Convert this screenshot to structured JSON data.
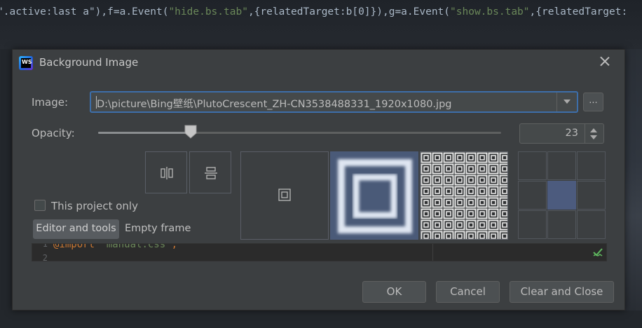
{
  "background_editor": {
    "p1": "\".active:last a\"),f=a.Event(",
    "p2": "\"hide.bs.tab\"",
    "p3": ",{relatedTarget:b[0]}),g=a.Event(",
    "p4": "\"show.bs.tab\"",
    "p5": ",{relatedTarget:"
  },
  "dialog": {
    "title": "Background Image",
    "app_logo_text": "WS",
    "image_label": "Image:",
    "image_path": "D:\\picture\\Bing壁纸\\PlutoCrescent_ZH-CN3538488331_1920x1080.jpg",
    "browse_label": "...",
    "opacity_label": "Opacity:",
    "opacity_value": "23",
    "opacity_fraction": 0.23,
    "this_project_label": "This project only",
    "this_project_checked": false,
    "tabs": [
      "Editor and tools",
      "Empty frame"
    ],
    "preview": {
      "line1": "1",
      "line2": "2",
      "keyword": "@import",
      "string": "\"manual.css\"",
      "semicolon": ";"
    },
    "buttons": {
      "ok": "OK",
      "cancel": "Cancel",
      "clear": "Clear and Close"
    }
  },
  "colors": {
    "dialog_bg": "#3c3f41",
    "accent_focus": "#3d6ea9",
    "selected_fill": "#4a5a78",
    "string_green": "#6a8759",
    "keyword_orange": "#cc7832"
  }
}
